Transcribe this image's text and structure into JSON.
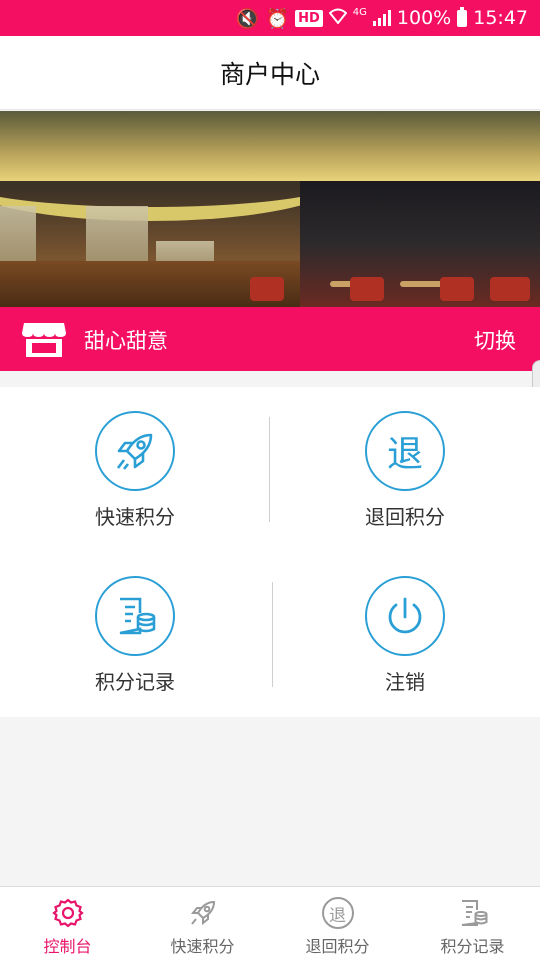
{
  "status_bar": {
    "hd_badge": "HD",
    "network": "4G",
    "battery": "100%",
    "time": "15:47"
  },
  "header": {
    "title": "商户中心"
  },
  "store": {
    "name": "甜心甜意",
    "switch_label": "切换"
  },
  "actions": [
    {
      "label": "快速积分",
      "icon": "rocket-icon"
    },
    {
      "label": "退回积分",
      "icon": "refund-icon",
      "glyph": "退"
    },
    {
      "label": "积分记录",
      "icon": "records-icon"
    },
    {
      "label": "注销",
      "icon": "power-icon"
    }
  ],
  "tabs": [
    {
      "label": "控制台",
      "icon": "gear-icon",
      "active": true
    },
    {
      "label": "快速积分",
      "icon": "rocket-icon",
      "active": false
    },
    {
      "label": "退回积分",
      "icon": "refund-icon",
      "glyph": "退",
      "active": false
    },
    {
      "label": "积分记录",
      "icon": "records-icon",
      "active": false
    }
  ],
  "colors": {
    "brand": "#f50f62",
    "accent": "#2a9fd6",
    "active_tab": "#e8156a"
  }
}
